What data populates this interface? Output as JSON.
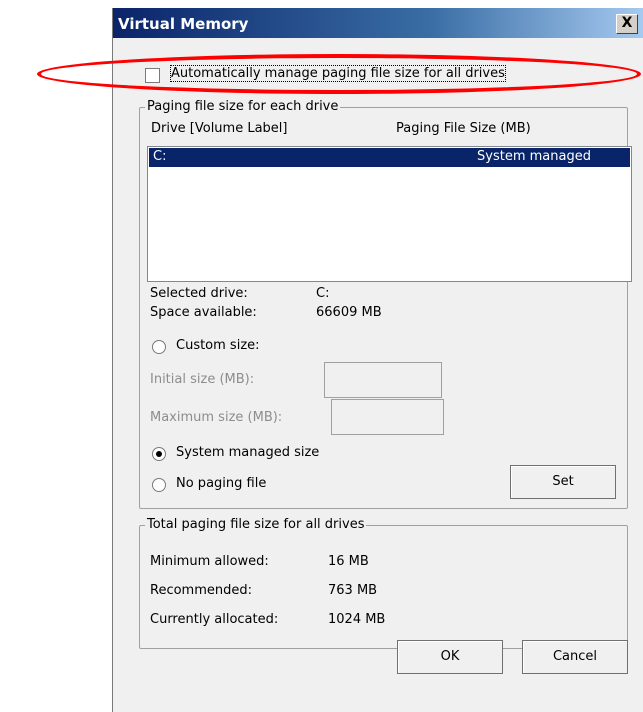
{
  "window": {
    "title": "Virtual Memory",
    "close_glyph": "X"
  },
  "auto_manage": {
    "label": "Automatically manage paging file size for all drives",
    "checked": false
  },
  "paging_group": {
    "legend": "Paging file size for each drive",
    "col_drive": "Drive  [Volume Label]",
    "col_size": "Paging File Size (MB)",
    "rows": [
      {
        "drive": "C:",
        "size": "System managed",
        "selected": true
      }
    ]
  },
  "drive_info": {
    "selected_label": "Selected drive:",
    "selected_value": "C:",
    "space_label": "Space available:",
    "space_value": "66609 MB"
  },
  "options": {
    "custom_size": "Custom size:",
    "initial_size": "Initial size (MB):",
    "maximum_size": "Maximum size (MB):",
    "system_managed": "System managed size",
    "no_paging": "No paging file",
    "selected": "system_managed",
    "set_button": "Set"
  },
  "total_group": {
    "legend": "Total paging file size for all drives",
    "min_label": "Minimum allowed:",
    "min_value": "16 MB",
    "rec_label": "Recommended:",
    "rec_value": "763 MB",
    "alloc_label": "Currently allocated:",
    "alloc_value": "1024 MB"
  },
  "buttons": {
    "ok": "OK",
    "cancel": "Cancel"
  },
  "colors": {
    "highlight_ring": "#ff0000",
    "selection": "#0a246a",
    "titlebar": "#0a246a"
  }
}
